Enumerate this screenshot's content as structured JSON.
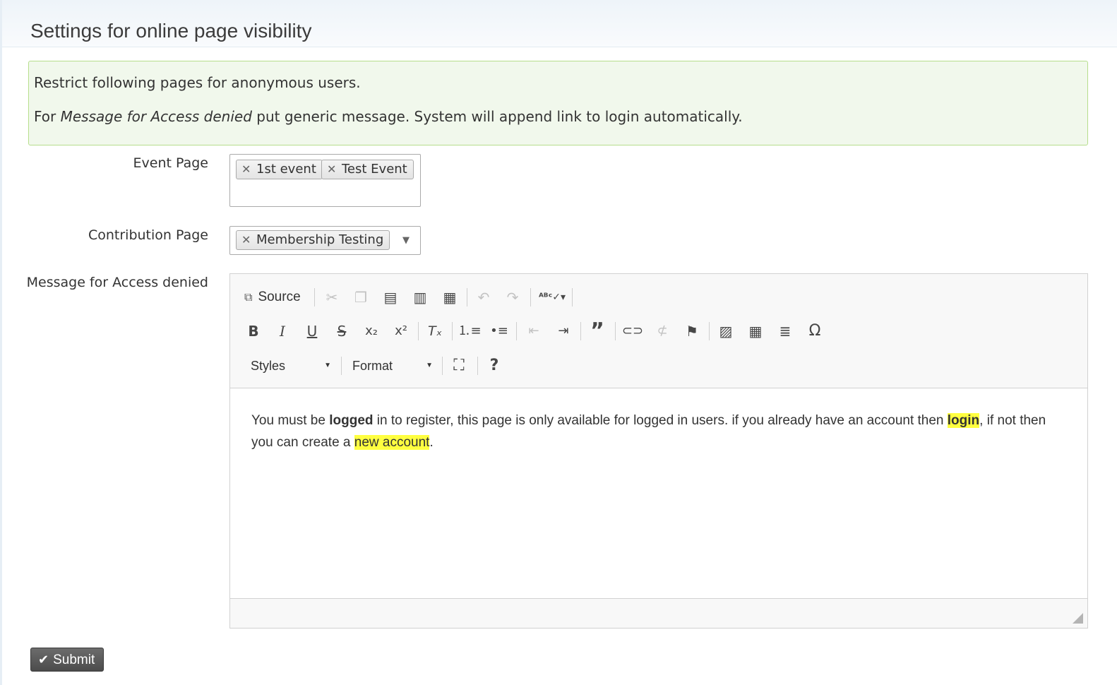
{
  "page": {
    "title": "Settings for online page visibility"
  },
  "help": {
    "line1": "Restrict following pages for anonymous users.",
    "line2_prefix": "For ",
    "line2_em": "Message for Access denied",
    "line2_suffix": " put generic message. System will append link to login automatically."
  },
  "event_page": {
    "label": "Event Page",
    "selected": [
      "1st event",
      "Test Event"
    ]
  },
  "contribution_page": {
    "label": "Contribution Page",
    "selected": [
      "Membership Testing"
    ]
  },
  "access_denied": {
    "label": "Message for Access denied",
    "toolbar": {
      "source_label": "Source",
      "styles_label": "Styles",
      "format_label": "Format",
      "help_label": "?"
    },
    "content": {
      "p1": "You must be ",
      "bold1": "logged",
      "p2": " in to register, this page is only available for logged in users. if you already have an account then ",
      "link1": "login",
      "p3": ", if not then you can create a ",
      "link2": "new account",
      "p4": "."
    }
  },
  "actions": {
    "submit_label": "Submit"
  },
  "colors": {
    "help_bg": "#f1f8ec",
    "help_border": "#b6de8c",
    "highlight": "#ffff40",
    "submit_bg": "#5a5a5a"
  },
  "icons": [
    "remove-tag-icon",
    "dropdown-arrow-icon",
    "source-icon",
    "cut-icon",
    "copy-icon",
    "paste-icon",
    "paste-text-icon",
    "paste-word-icon",
    "undo-icon",
    "redo-icon",
    "spellcheck-icon",
    "bold-icon",
    "italic-icon",
    "underline-icon",
    "strike-icon",
    "subscript-icon",
    "superscript-icon",
    "remove-format-icon",
    "numbered-list-icon",
    "bulleted-list-icon",
    "outdent-icon",
    "indent-icon",
    "blockquote-icon",
    "link-icon",
    "unlink-icon",
    "anchor-icon",
    "image-icon",
    "table-icon",
    "horizontal-line-icon",
    "special-char-icon",
    "maximize-icon",
    "help-icon",
    "check-icon",
    "resize-grip-icon"
  ]
}
